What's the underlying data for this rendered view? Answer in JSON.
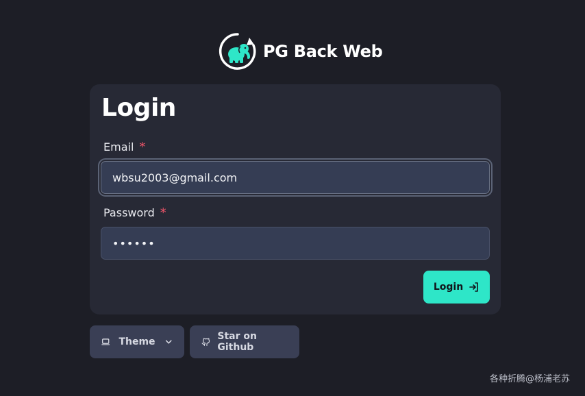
{
  "brand": {
    "name": "PG Back Web",
    "logo_icon": "elephant-refresh-icon",
    "accent": "#2ee6c8"
  },
  "login_form": {
    "title": "Login",
    "email_label": "Email",
    "email_value": "wbsu2003@gmail.com",
    "password_label": "Password",
    "password_value": "••••••",
    "required_mark": "*",
    "submit_label": "Login",
    "submit_icon": "login-arrow-icon"
  },
  "footer_buttons": {
    "theme_label": "Theme",
    "theme_icon": "laptop-icon",
    "theme_chevron": "chevron-down-icon",
    "github_label": "Star on Github",
    "github_icon": "github-icon"
  },
  "watermark": "各种折腾@杨浦老苏"
}
